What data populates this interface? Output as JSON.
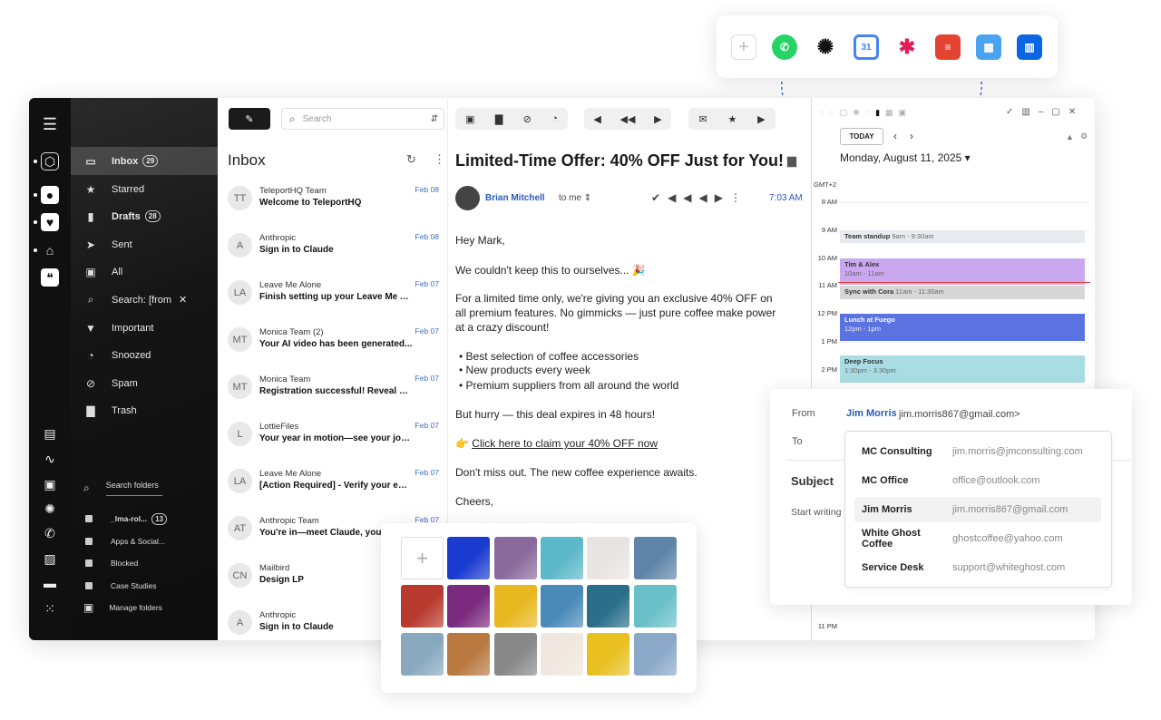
{
  "sidebar": {
    "items": [
      {
        "label": "Inbox",
        "badge": "29",
        "icon": "inbox-icon",
        "active": true
      },
      {
        "label": "Starred",
        "icon": "star-icon"
      },
      {
        "label": "Drafts",
        "badge": "28",
        "icon": "file-icon"
      },
      {
        "label": "Sent",
        "icon": "send-icon"
      },
      {
        "label": "All",
        "icon": "archive-icon"
      },
      {
        "label": "Search: [from",
        "icon": "search-icon"
      },
      {
        "label": "Important",
        "icon": "bookmark-icon"
      },
      {
        "label": "Snoozed",
        "icon": "clock-icon"
      },
      {
        "label": "Spam",
        "icon": "block-icon"
      },
      {
        "label": "Trash",
        "icon": "trash-icon"
      }
    ],
    "search_folders_placeholder": "Search folders",
    "folders": [
      {
        "label": "_lma-rol...",
        "badge": "13"
      },
      {
        "label": "Apps & Social..."
      },
      {
        "label": "Blocked"
      },
      {
        "label": "Case Studies"
      }
    ],
    "manage_folders": "Manage folders"
  },
  "list": {
    "search_placeholder": "Search",
    "title": "Inbox",
    "rows": [
      {
        "initials": "TT",
        "sender": "TeleportHQ Team",
        "subject": "Welcome to TeleportHQ",
        "date": "Feb 08"
      },
      {
        "initials": "A",
        "sender": "Anthropic",
        "subject": "Sign in to Claude",
        "date": "Feb 08"
      },
      {
        "initials": "LA",
        "sender": "Leave Me Alone",
        "subject": "Finish setting up your Leave Me A...",
        "date": "Feb 07"
      },
      {
        "initials": "MT",
        "sender": "Monica Team   (2)",
        "subject": "Your AI video has been generated...",
        "date": "Feb 07"
      },
      {
        "initials": "MT",
        "sender": "Monica Team",
        "subject": "Registration successful! Reveal M...",
        "date": "Feb 07"
      },
      {
        "initials": "L",
        "sender": "LottieFiles",
        "subject": "Your year in motion—see your jou...",
        "date": "Feb 07"
      },
      {
        "initials": "LA",
        "sender": "Leave Me Alone",
        "subject": "[Action Required] - Verify your em...",
        "date": "Feb 07"
      },
      {
        "initials": "AT",
        "sender": "Anthropic Team",
        "subject": "You're in—meet Claude, your new...",
        "date": "Feb 07"
      },
      {
        "initials": "CN",
        "sender": "Mailbird",
        "subject": "Design LP",
        "date": ""
      },
      {
        "initials": "A",
        "sender": "Anthropic",
        "subject": "Sign in to Claude",
        "date": ""
      }
    ]
  },
  "email": {
    "subject": "Limited-Time Offer: 40% OFF Just for You!",
    "from_name": "Brian Mitchell",
    "to": "to me",
    "time": "7:03 AM",
    "greeting": "Hey Mark,",
    "p1": "We couldn't keep this to ourselves... 🎉",
    "p2a": "For a limited time only, we're giving you an exclusive 40% OFF on",
    "p2b": "all premium features. No gimmicks — just pure coffee make power",
    "p2c": "at a crazy discount!",
    "bullets": [
      "Best selection of coffee accessories",
      "New products every week",
      "Premium suppliers from all around the world"
    ],
    "p3": "But hurry — this deal expires in 48 hours!",
    "cta_prefix": "👉 ",
    "cta": "Click here to claim your 40% OFF now",
    "p4": "Don't miss out. The new coffee experience awaits.",
    "signoff": "Cheers,"
  },
  "calendar": {
    "today_btn": "TODAY",
    "date_label": "Monday, August 11, 2025 ▾",
    "tz": "GMT+2",
    "hours": [
      "8 AM",
      "9 AM",
      "10 AM",
      "11 AM",
      "12 PM",
      "1 PM",
      "2 PM"
    ],
    "last_hour": "11 PM",
    "events": [
      {
        "title": "Team standup",
        "time": "9am - 9:30am",
        "color": "#e8ecf0"
      },
      {
        "title": "Tim & Alex",
        "time": "10am - 11am",
        "color": "#c9a8f0"
      },
      {
        "title": "Sync with Cora",
        "time": "11am - 11:30am",
        "color": "#d7d7d7"
      },
      {
        "title": "Lunch at Fuego",
        "time": "12pm - 1pm",
        "color": "#5b73e0"
      },
      {
        "title": "Deep Focus",
        "time": "1:30pm - 3:30pm",
        "color": "#a8dde3"
      }
    ]
  },
  "integrations": [
    "add-icon",
    "whatsapp-icon",
    "openai-icon",
    "google-calendar-icon",
    "slack-icon",
    "todoist-icon",
    "calendar-app-icon",
    "trello-icon"
  ],
  "compose": {
    "from_label": "From",
    "from_name": "Jim Morris",
    "from_email": "jim.morris867@gmail.com>",
    "to_label": "To",
    "subject_label": "Subject",
    "body_placeholder": "Start writing",
    "contacts": [
      {
        "name": "MC Consulting",
        "email": "jim.morris@jmconsulting.com"
      },
      {
        "name": "MC Office",
        "email": "office@outlook.com"
      },
      {
        "name": "Jim Morris",
        "email": "jim.morris867@gmail.com"
      },
      {
        "name": "White Ghost Coffee",
        "email": "ghostcoffee@yahoo.com"
      },
      {
        "name": "Service Desk",
        "email": "support@whiteghost.com"
      }
    ]
  },
  "image_picker": {
    "add_symbol": "+",
    "tiles": [
      "#1a3bd0",
      "#8a6a9c",
      "#5bb8c8",
      "#e8e4e2",
      "#5f86a8",
      "#b83a2e",
      "#7a2a7e",
      "#e8b820",
      "#4a8ab8",
      "#2a6e8a",
      "#6ac0c8",
      "#88a8c0",
      "#b87840",
      "#888888",
      "#f0e8e0",
      "#e8c020",
      "#8aa8c8"
    ]
  }
}
